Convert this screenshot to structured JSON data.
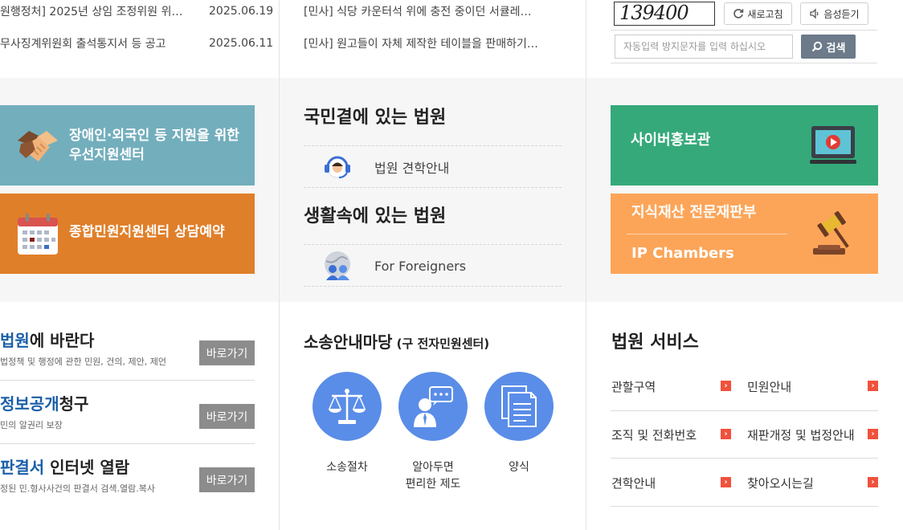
{
  "notices_left": [
    {
      "title": "원행정처] 2025년 상임 조정위원 위…",
      "date": "2025.06.19"
    },
    {
      "title": "무사징계위원회 출석통지서 등 공고",
      "date": "2025.06.11"
    }
  ],
  "notices_mid": [
    {
      "title": "[민사] 식당 카운터석 위에 충전 중이던 서큘레…"
    },
    {
      "title": "[민사] 원고들이 자체 제작한 테이블을 판매하기…"
    }
  ],
  "captcha": {
    "code": "139400",
    "refresh_label": "새로고침",
    "audio_label": "음성듣기",
    "input_placeholder": "자동입력 방지문자를 입력 하십시오",
    "search_label": "검색"
  },
  "banners": {
    "support_center": {
      "line1": "장애인·외국인 등 지원을 위한",
      "line2": "우선지원센터",
      "color": "#73aebd"
    },
    "reservation": {
      "label": "종합민원지원센터 상담예약",
      "color": "#e07f2a"
    },
    "cyber": {
      "label": "사이버홍보관",
      "color": "#35a97a"
    },
    "ip": {
      "line1": "지식재산 전문재판부",
      "line2": "IP Chambers",
      "color": "#fca559"
    }
  },
  "middle": {
    "title1": "국민곁에 있는 법원",
    "item1": "법원 견학안내",
    "title2": "생활속에 있는 법원",
    "item2": "For Foreigners"
  },
  "bottom_left": [
    {
      "hl": "법원",
      "rest": "에 바란다",
      "sub": "법정책 및 행정에 관한 민원, 건의, 제안, 제언",
      "btn": "바로가기"
    },
    {
      "hl": "정보공개",
      "rest": "청구",
      "sub": "민의 알권리 보장",
      "btn": "바로가기"
    },
    {
      "hl": "판결서",
      "rest": " 인터넷 열람",
      "sub": "정된 민.형사사건의 판결서 검색.열람.복사",
      "btn": "바로가기"
    }
  ],
  "litigation": {
    "title": "소송안내마당",
    "title_small": " (구 전자민원센터)",
    "items": [
      {
        "label": "소송절차"
      },
      {
        "label1": "알아두면",
        "label2": "편리한 제도"
      },
      {
        "label": "양식"
      }
    ]
  },
  "services": {
    "title": "법원 서비스",
    "items": [
      "관할구역",
      "민원안내",
      "조직 및 전화번호",
      "재판개정 및 법정안내",
      "견학안내",
      "찾아오시는길"
    ]
  }
}
